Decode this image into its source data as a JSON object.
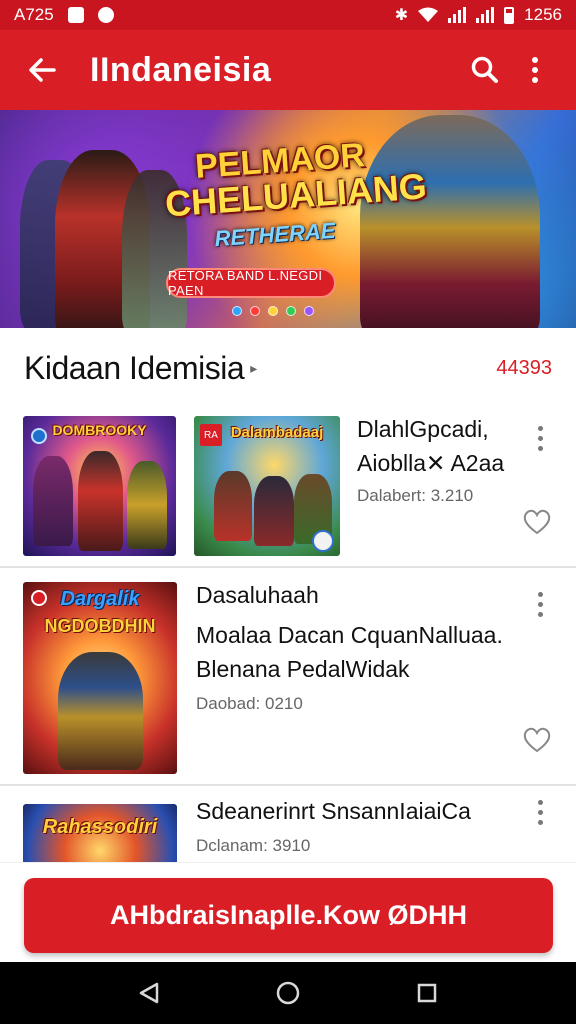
{
  "status_bar": {
    "time": "A725",
    "right_text": "1256",
    "icons": [
      "notification-icon",
      "notification-icon",
      "bluetooth-icon",
      "wifi-icon",
      "signal-icon",
      "signal-icon",
      "battery-icon"
    ]
  },
  "app_bar": {
    "title": "IIndaneisia",
    "icons": [
      "back-arrow-icon",
      "search-icon",
      "more-vert-icon"
    ]
  },
  "banner": {
    "title_line1": "PELMAOR",
    "title_line2": "CHELUALIANG",
    "subtitle": "RETHERAE",
    "button_label": "RETORA BAND L.NEGDI PAEN",
    "indicator_dots": [
      "#2ea6ff",
      "#ff3b3b",
      "#ffd23a",
      "#33cc55",
      "#9a55ff"
    ]
  },
  "section": {
    "title": "Kidaan Idemisia",
    "count": "44393"
  },
  "items": [
    {
      "name": "DlahlGpcadi,",
      "subtitle": "Aioblla✕ A2aa",
      "meta": "Dalabert: 3.210",
      "thumb_left_title": "DOMBROOKY",
      "thumb_right_title": "Dalambadaaj",
      "thumb_right_badge": "RA"
    },
    {
      "name": "Dasaluhaah",
      "subtitle_line1": "Moalaa Dacan CquanNalluaa.",
      "subtitle_line2": "Blenana PedalWidak",
      "meta": "Daobad: 0210",
      "thumb_title_line1": "Dargalik",
      "thumb_title_line2": "NGDOBDHIN"
    },
    {
      "name": "Sdeanerinrt SnsannIaiaiCa",
      "meta": "Dclanam: 3910",
      "thumb_title": "Rahassodiri"
    }
  ],
  "cta": {
    "label": "AHbdraisInaplle.Kow ØDHH"
  },
  "nav_bar": {
    "icons": [
      "back-triangle-icon",
      "home-circle-icon",
      "recents-square-icon"
    ]
  },
  "colors": {
    "primary": "#d91e26",
    "status_bar": "#c8151f",
    "count_text": "#d91e26"
  }
}
